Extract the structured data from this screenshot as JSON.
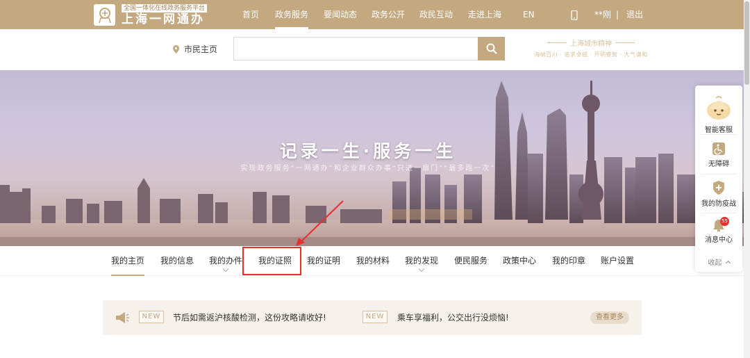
{
  "header": {
    "logo_subtitle": "全国一体化在线政务服务平台",
    "logo_title": "上海一网通办",
    "nav": [
      {
        "label": "首页",
        "active": false
      },
      {
        "label": "政务服务",
        "active": true
      },
      {
        "label": "要闻动态",
        "active": false
      },
      {
        "label": "政务公开",
        "active": false
      },
      {
        "label": "政民互动",
        "active": false
      },
      {
        "label": "走进上海",
        "active": false
      },
      {
        "label": "EN",
        "active": false
      }
    ],
    "user_name": "**刚",
    "separator": "|",
    "logout": "退出"
  },
  "search": {
    "location_label": "市民主页",
    "placeholder": "",
    "spirit_title": "上海城市精神",
    "spirit_subtitle": "海纳百川 · 追求卓越 · 开明睿智 · 大气谦和"
  },
  "banner": {
    "title": "记录一生·服务一生",
    "subtitle": "实现政务服务“一网通办”和企业群众办事“只进一扇门”“最多跑一次”"
  },
  "tabs": [
    {
      "label": "我的主页",
      "active": true,
      "dropdown": false
    },
    {
      "label": "我的信息",
      "active": false,
      "dropdown": false
    },
    {
      "label": "我的办件",
      "active": false,
      "dropdown": true
    },
    {
      "label": "我的证照",
      "active": false,
      "dropdown": false,
      "highlighted": true
    },
    {
      "label": "我的证明",
      "active": false,
      "dropdown": false
    },
    {
      "label": "我的材料",
      "active": false,
      "dropdown": false
    },
    {
      "label": "我的发现",
      "active": false,
      "dropdown": true
    },
    {
      "label": "便民服务",
      "active": false,
      "dropdown": false
    },
    {
      "label": "政策中心",
      "active": false,
      "dropdown": false
    },
    {
      "label": "我的印章",
      "active": false,
      "dropdown": false
    },
    {
      "label": "账户设置",
      "active": false,
      "dropdown": false
    }
  ],
  "notice": {
    "badge": "NEW",
    "items": [
      "节后如需返沪核酸检测，这份攻略请收好!",
      "乘车享福利，公交出行没烦恼!"
    ],
    "more": "查看更多"
  },
  "side_panel": {
    "items": [
      {
        "label": "智能客服",
        "icon": "bun-mascot-icon"
      },
      {
        "label": "无障碍",
        "icon": "accessibility-icon"
      },
      {
        "label": "我的防疫战",
        "icon": "shield-plus-icon"
      },
      {
        "label": "消息中心",
        "icon": "bell-icon",
        "badge": "55"
      }
    ],
    "collapse": "收起"
  },
  "colors": {
    "brand_gold": "#c3a880",
    "highlight_red": "#e63030"
  }
}
